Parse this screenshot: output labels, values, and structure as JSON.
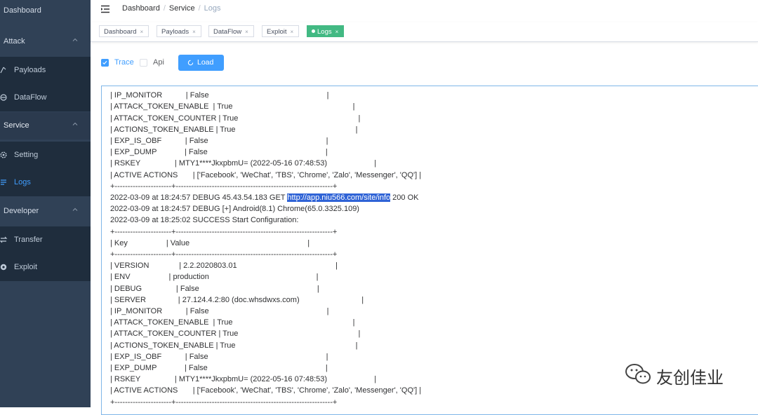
{
  "sidebar": {
    "top_item": "Dashboard",
    "groups": [
      {
        "label": "Attack",
        "items": [
          {
            "label": "Payloads"
          },
          {
            "label": "DataFlow"
          }
        ]
      },
      {
        "label": "Service",
        "items": [
          {
            "label": "Setting"
          },
          {
            "label": "Logs"
          }
        ]
      },
      {
        "label": "Developer",
        "items": [
          {
            "label": "Transfer"
          },
          {
            "label": "Exploit"
          }
        ]
      }
    ],
    "active_item": "Logs",
    "active_color": "#409eff"
  },
  "header": {
    "breadcrumb": [
      "Dashboard",
      "Service",
      "Logs"
    ],
    "separator": "/"
  },
  "tags": [
    {
      "label": "Dashboard",
      "close": "×"
    },
    {
      "label": "Payloads",
      "close": "×"
    },
    {
      "label": "DataFlow",
      "close": "×"
    },
    {
      "label": "Exploit",
      "close": "×"
    },
    {
      "label": "Logs",
      "close": "×",
      "active": true
    }
  ],
  "controls": {
    "trace": {
      "label": "Trace",
      "checked": true
    },
    "api": {
      "label": "Api",
      "checked": false
    },
    "load_button": "Load"
  },
  "log": {
    "lines": [
      "+----------------------+-------------------------------------------------------------+",
      "| IP_MONITOR           | False                                                       |",
      "| ATTACK_TOKEN_ENABLE  | True                                                        |",
      "| ATTACK_TOKEN_COUNTER | True                                                        |",
      "| ACTIONS_TOKEN_ENABLE | True                                                        |",
      "| EXP_IS_OBF           | False                                                       |",
      "| EXP_DUMP             | False                                                       |",
      "| RSKEY                | MTY1****JkxpbmU= (2022-05-16 07:48:53)                      |",
      "| ACTIVE ACTIONS       | ['Facebook', 'WeChat', 'TBS', 'Chrome', 'Zalo', 'Messenger', 'QQ'] |",
      "+----------------------+-------------------------------------------------------------+",
      {
        "pre": "2022-03-09 at 18:24:57 DEBUG 45.43.54.183 GET ",
        "link": "http://app.niu566.com/site/info",
        "post": " 200 OK"
      },
      "2022-03-09 at 18:24:57 DEBUG [+] Android(8.1) Chrome(65.0.3325.109)",
      "2022-03-09 at 18:25:02 SUCCESS Start Configuration:",
      "+----------------------+-------------------------------------------------------------+",
      "| Key                  | Value                                                       |",
      "+----------------------+-------------------------------------------------------------+",
      "| VERSION              | 2.2.2020803.01                                              |",
      "| ENV                  | production                                                  |",
      "| DEBUG                | False                                                       |",
      "| SERVER               | 27.124.4.2:80 (doc.whsdwxs.com)                             |",
      "| IP_MONITOR           | False                                                       |",
      "| ATTACK_TOKEN_ENABLE  | True                                                        |",
      "| ATTACK_TOKEN_COUNTER | True                                                        |",
      "| ACTIONS_TOKEN_ENABLE | True                                                        |",
      "| EXP_IS_OBF           | False                                                       |",
      "| EXP_DUMP             | False                                                       |",
      "| RSKEY                | MTY1****JkxpbmU= (2022-05-16 07:48:53)                      |",
      "| ACTIVE ACTIONS       | ['Facebook', 'WeChat', 'TBS', 'Chrome', 'Zalo', 'Messenger', 'QQ'] |",
      "+----------------------+-------------------------------------------------------------+"
    ]
  },
  "watermark": {
    "text": "友创佳业",
    "icon": "wechat-icon"
  },
  "colors": {
    "sidebar_bg": "#304156",
    "submenu_bg": "#1f2d3d",
    "primary": "#409eff",
    "tag_active": "#42b983",
    "highlight": "#2f63d6"
  }
}
